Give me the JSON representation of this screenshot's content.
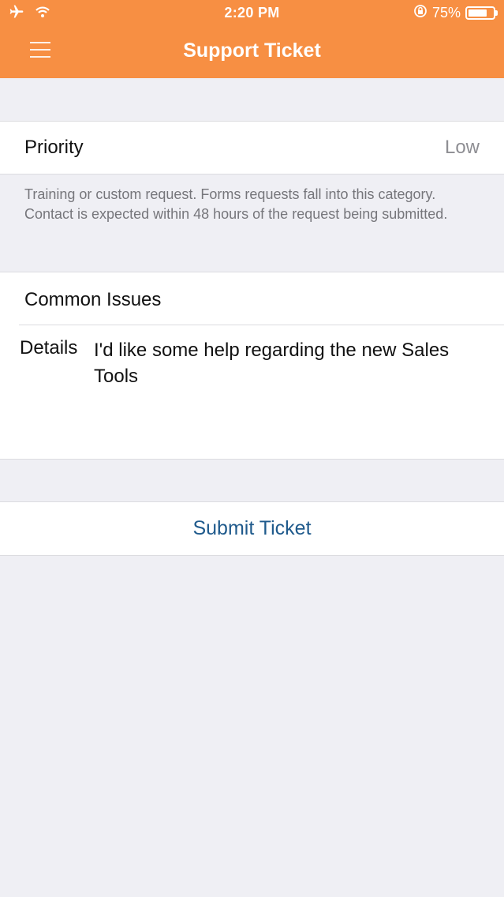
{
  "status_bar": {
    "time": "2:20 PM",
    "battery_text": "75%",
    "battery_level": 0.75,
    "icons": [
      "airplane-icon",
      "wifi-icon",
      "rotation-lock-icon",
      "battery-icon"
    ]
  },
  "nav": {
    "title": "Support Ticket",
    "menu_icon": "hamburger-menu-icon"
  },
  "priority": {
    "label": "Priority",
    "value": "Low",
    "description": "Training or custom request. Forms requests fall into this category. Contact is expected within 48 hours of the request being submitted."
  },
  "issues": {
    "label": "Common Issues",
    "details_label": "Details",
    "details_value": "I'd like some help regarding the new Sales Tools"
  },
  "submit": {
    "label": "Submit Ticket"
  },
  "colors": {
    "nav_background": "#f78f43",
    "page_background": "#efeff4",
    "submit_text": "#1f5a8c",
    "secondary_text": "#8e8e93"
  }
}
